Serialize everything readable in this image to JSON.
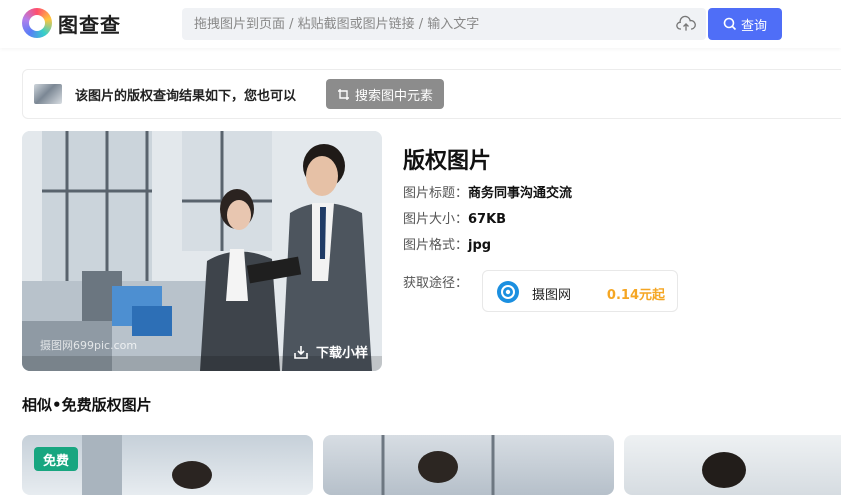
{
  "header": {
    "logo_text": "图查查",
    "search_placeholder": "拖拽图片到页面 / 粘贴截图或图片链接 / 输入文字",
    "search_button_label": "查询"
  },
  "result_bar": {
    "text": "该图片的版权查询结果如下，您也可以",
    "search_elements_button": "搜索图中元素"
  },
  "main_image": {
    "download_label": "下载小样",
    "watermark": "摄图网699pic.com"
  },
  "info": {
    "title": "版权图片",
    "rows": [
      {
        "key": "图片标题：",
        "value": "商务同事沟通交流"
      },
      {
        "key": "图片大小：",
        "value": "67KB"
      },
      {
        "key": "图片格式：",
        "value": "jpg"
      }
    ],
    "source_label": "获取途径：",
    "source": {
      "name": "摄图网",
      "price": "0.14元起"
    }
  },
  "similar": {
    "title": "相似•免费版权图片",
    "badge": "免费"
  },
  "colors": {
    "accent": "#4f6ef7",
    "price": "#f5a623",
    "free_badge": "#18a680"
  }
}
